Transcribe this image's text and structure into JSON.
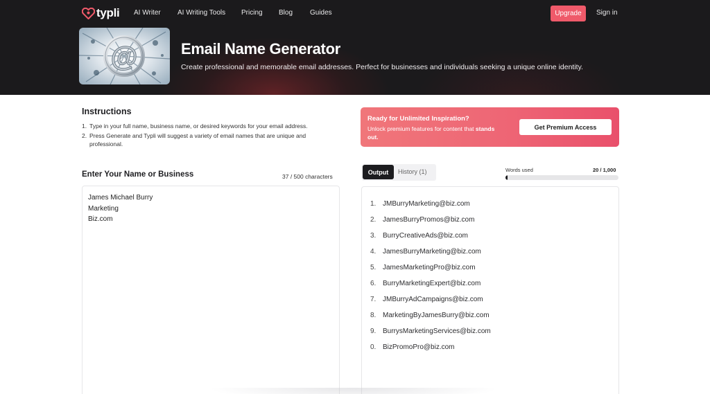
{
  "nav": {
    "logo_text": "typli",
    "links": [
      "AI Writer",
      "AI Writing Tools",
      "Pricing",
      "Blog",
      "Guides"
    ],
    "upgrade_label": "Upgrade",
    "signin_label": "Sign in"
  },
  "hero": {
    "title": "Email Name Generator",
    "subtitle": "Create professional and memorable email addresses. Perfect for businesses and individuals seeking a unique online identity."
  },
  "instructions": {
    "title": "Instructions",
    "items": [
      "Type in your full name, business name, or desired keywords for your email address.",
      "Press Generate and Typli will suggest a variety of email names that are unique and professional."
    ]
  },
  "promo": {
    "title": "Ready for Unlimited Inspiration?",
    "text_before": "Unlock premium features for content that ",
    "text_bold": "stands out.",
    "button_label": "Get Premium Access"
  },
  "input": {
    "label": "Enter Your Name or Business",
    "char_count": "37 / 500 characters",
    "lines": [
      "James Michael Burry",
      "Marketing",
      "Biz.com"
    ]
  },
  "output": {
    "tab_output": "Output",
    "tab_history": "History (1)",
    "words_label": "Words used",
    "words_count": "20 / 1,000",
    "words_used_fraction": 0.02,
    "items": [
      {
        "num": "1.",
        "text": "JMBurryMarketing@biz.com"
      },
      {
        "num": "2.",
        "text": "JamesBurryPromos@biz.com"
      },
      {
        "num": "3.",
        "text": "BurryCreativeAds@biz.com"
      },
      {
        "num": "4.",
        "text": "JamesBurryMarketing@biz.com"
      },
      {
        "num": "5.",
        "text": "JamesMarketingPro@biz.com"
      },
      {
        "num": "6.",
        "text": "BurryMarketingExpert@biz.com"
      },
      {
        "num": "7.",
        "text": "JMBurryAdCampaigns@biz.com"
      },
      {
        "num": "8.",
        "text": "MarketingByJamesBurry@biz.com"
      },
      {
        "num": "9.",
        "text": "BurrysMarketingServices@biz.com"
      },
      {
        "num": "0.",
        "text": "BizPromoPro@biz.com"
      }
    ]
  },
  "colors": {
    "header_bg": "#1b1a1c",
    "accent": "#ef5a6a",
    "promo_start": "#f0767a",
    "promo_end": "#e9506b"
  }
}
